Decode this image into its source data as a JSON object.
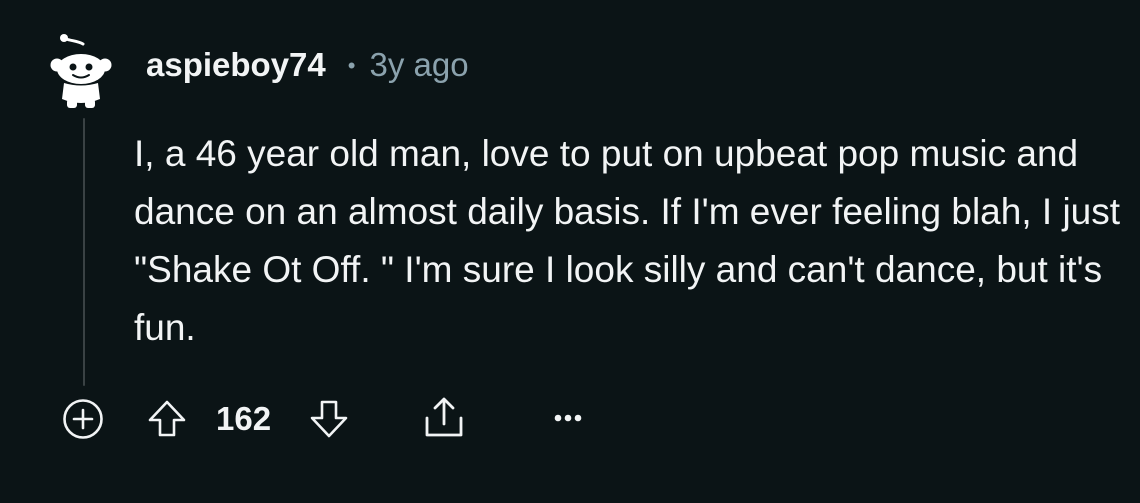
{
  "comment": {
    "author": "aspieboy74",
    "separator": "•",
    "timestamp": "3y ago",
    "body": "I, a 46 year old man, love to put on upbeat pop music and dance on an almost daily basis. If I'm ever feeling blah, I just \"Shake Ot Off. \" I'm sure I look silly and can't dance, but it's fun.",
    "score": "162"
  },
  "icons": {
    "avatar": "snoo-avatar-icon",
    "expand": "plus-circle-icon",
    "upvote": "arrow-up-icon",
    "downvote": "arrow-down-icon",
    "share": "share-icon",
    "more": "more-dots-icon"
  },
  "colors": {
    "background": "#0b1416",
    "text": "#f2f4f5",
    "muted": "#8ba2ad",
    "thread_line": "#3a4244"
  }
}
